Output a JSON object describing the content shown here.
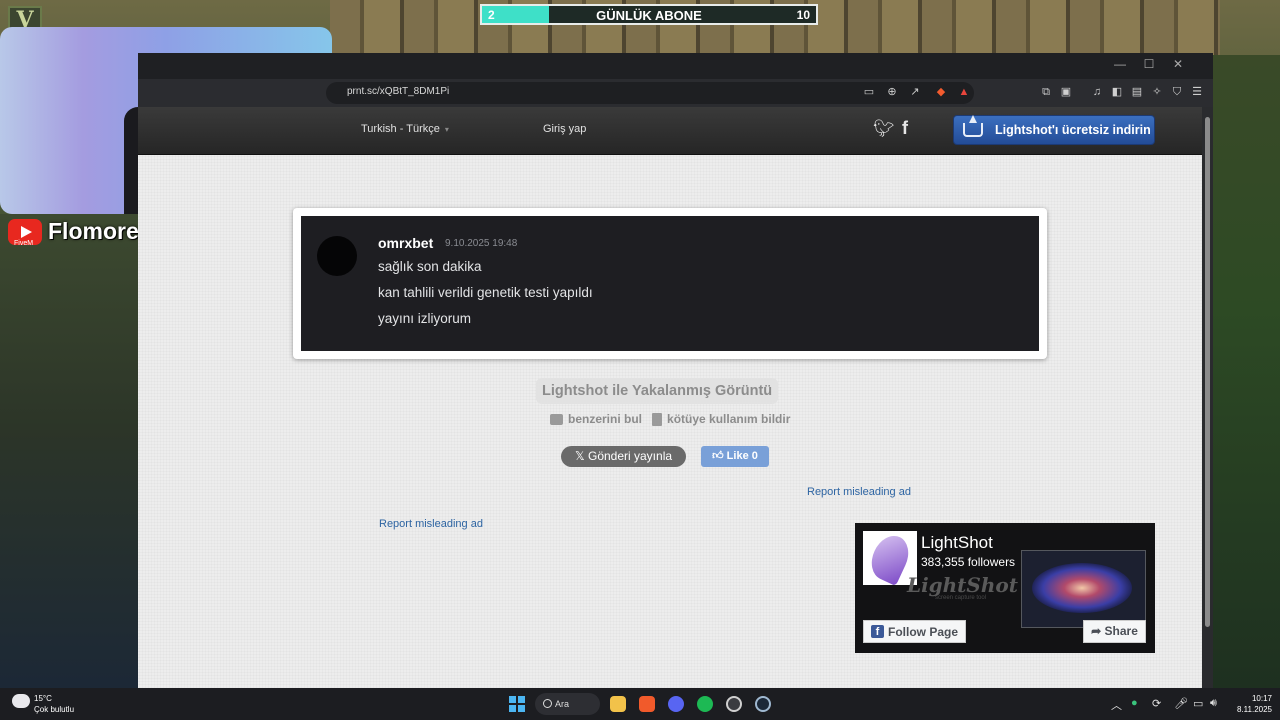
{
  "overlay": {
    "subscriber_goal": {
      "title": "GÜNLÜK ABONE",
      "current": "2",
      "target": "10",
      "progress": 0.2
    },
    "channel": {
      "name": "Flomore",
      "sub": "FiveM"
    }
  },
  "browser": {
    "url": "prnt.sc/xQBtT_8DM1Pi"
  },
  "site": {
    "language": "Turkish - Türkçe",
    "login": "Giriş yap",
    "download_button": "Lightshot'ı ücretsiz indirin",
    "screenshot": {
      "username": "omrxbet",
      "timestamp": "9.10.2025 19:48",
      "lines": [
        "sağlık son dakika",
        "kan tahlili verildi genetik testi yapıldı",
        "yayını izliyorum"
      ]
    },
    "caption": "Lightshot ile Yakalanmış Görüntü",
    "find_similar": "benzerini bul",
    "report_abuse": "kötüye kullanım bildir",
    "tweet_button": "Gönderi yayınla",
    "like_button": "Like",
    "like_count": "0",
    "report_ad_1": "Report misleading ad",
    "report_ad_2": "Report misleading ad",
    "fb_widget": {
      "title": "LightShot",
      "followers": "383,355 followers",
      "brand": "LightShot",
      "brand_sub": "screen capture tool",
      "follow": "Follow Page",
      "share": "Share"
    }
  },
  "taskbar": {
    "temperature": "15°C",
    "weather": "Çok bulutlu",
    "search": "Ara",
    "time": "10:17",
    "date": "8.11.2025"
  },
  "colors": {
    "accent": "#3ee0c8",
    "download_button": "#234c97",
    "link": "#2d64a2"
  }
}
